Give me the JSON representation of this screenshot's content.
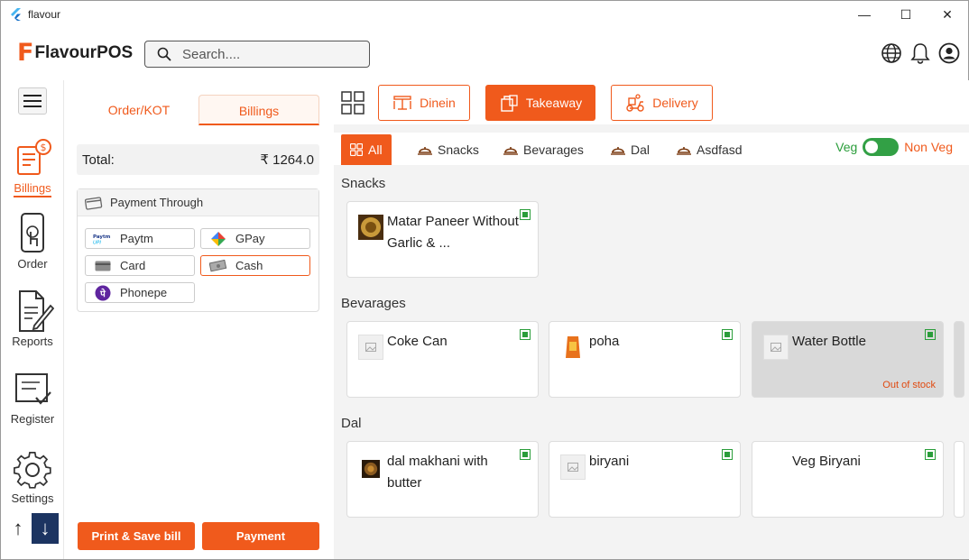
{
  "window": {
    "title": "flavour",
    "min": "—",
    "max": "☐",
    "close": "✕"
  },
  "header": {
    "logo_letter": "F",
    "logo_text": "FlavourPOS",
    "search_placeholder": "Search....",
    "icons": [
      "globe-icon",
      "bell-icon",
      "account-icon"
    ]
  },
  "nav": {
    "items": [
      {
        "label": "Billings",
        "icon": "billing-icon",
        "active": true
      },
      {
        "label": "Order",
        "icon": "phone-touch-icon"
      },
      {
        "label": "Reports",
        "icon": "report-icon"
      },
      {
        "label": "Register",
        "icon": "register-icon"
      },
      {
        "label": "Settings",
        "icon": "gear-icon"
      }
    ],
    "up": "↑",
    "down": "↓"
  },
  "billing": {
    "tabs": [
      "Order/KOT",
      "Billings"
    ],
    "selected_tab": "Billings",
    "total_label": "Total:",
    "total_value": "₹ 1264.0",
    "payment_title": "Payment Through",
    "methods": [
      {
        "label": "Paytm",
        "icon": "paytm-icon"
      },
      {
        "label": "GPay",
        "icon": "gpay-icon"
      },
      {
        "label": "Card",
        "icon": "card-icon"
      },
      {
        "label": "Cash",
        "icon": "cash-icon",
        "selected": true
      },
      {
        "label": "Phonepe",
        "icon": "phonepe-icon"
      }
    ],
    "paytm_logo_text": "Paytm UPI",
    "print_button": "Print & Save bill",
    "payment_button": "Payment"
  },
  "order_types": [
    "Dinein",
    "Takeaway",
    "Delivery"
  ],
  "selected_order_type": "Takeaway",
  "categories": [
    "All",
    "Snacks",
    "Bevarages",
    "Dal",
    "Asdfasd"
  ],
  "selected_category": "All",
  "veg_toggle": {
    "veg_label": "Veg",
    "nonveg_label": "Non Veg",
    "state": "veg"
  },
  "sections": [
    {
      "title": "Snacks",
      "items": [
        {
          "name": "Matar Paneer Without Garlic & ...",
          "thumb": "food-photo-icon"
        }
      ]
    },
    {
      "title": "Bevarages",
      "items": [
        {
          "name": "Coke Can",
          "thumb": "image-placeholder-icon"
        },
        {
          "name": "poha",
          "thumb": "snack-packet-icon"
        },
        {
          "name": "Water Bottle",
          "thumb": "image-placeholder-icon",
          "out_of_stock": "Out of stock"
        }
      ]
    },
    {
      "title": "Dal",
      "items": [
        {
          "name": "dal makhani with butter",
          "thumb": "food-photo-icon"
        },
        {
          "name": "biryani",
          "thumb": "image-placeholder-icon"
        },
        {
          "name": "Veg Biryani",
          "thumb": "none"
        }
      ]
    }
  ],
  "colors": {
    "accent": "#f05a1c",
    "veg": "#2a9d3a",
    "nav_dark": "#1c3461"
  }
}
